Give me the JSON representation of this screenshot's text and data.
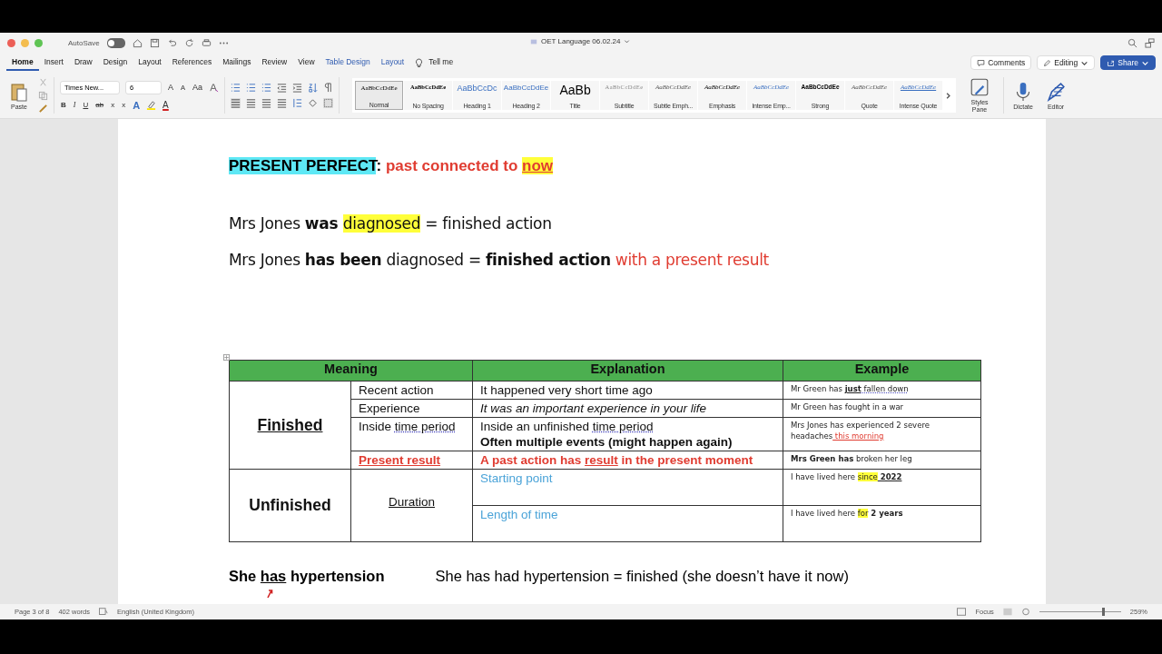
{
  "titlebar": {
    "autosave": {
      "label": "AutoSave",
      "on": false
    },
    "title": "OET Language 06.02.24"
  },
  "tabs": [
    {
      "label": "Home",
      "selected": true,
      "contextual": false
    },
    {
      "label": "Insert",
      "selected": false,
      "contextual": false
    },
    {
      "label": "Draw",
      "selected": false,
      "contextual": false
    },
    {
      "label": "Design",
      "selected": false,
      "contextual": false
    },
    {
      "label": "Layout",
      "selected": false,
      "contextual": false
    },
    {
      "label": "References",
      "selected": false,
      "contextual": false
    },
    {
      "label": "Mailings",
      "selected": false,
      "contextual": false
    },
    {
      "label": "Review",
      "selected": false,
      "contextual": false
    },
    {
      "label": "View",
      "selected": false,
      "contextual": false
    },
    {
      "label": "Table Design",
      "selected": false,
      "contextual": true
    },
    {
      "label": "Layout",
      "selected": false,
      "contextual": true
    }
  ],
  "tell_me": "Tell me",
  "actions": {
    "comments": "Comments",
    "editing": "Editing",
    "share": "Share"
  },
  "ribbon": {
    "paste": "Paste",
    "font": "Times New...",
    "size": "6",
    "case": "Aa",
    "grow": "A",
    "shrink": "A",
    "format_buttons": [
      {
        "label": "B",
        "kind": "bold"
      },
      {
        "label": "I",
        "kind": "italic"
      },
      {
        "label": "U",
        "kind": "underline"
      },
      {
        "label": "ab",
        "kind": "strike"
      },
      {
        "label": "x",
        "kind": "sub"
      },
      {
        "label": "x",
        "kind": "sup"
      }
    ],
    "effects": "A",
    "font_color": "A",
    "styles": [
      {
        "preview": "AaBbCcDdEe",
        "label": "Normal",
        "kind": "normal",
        "selected": true
      },
      {
        "preview": "AaBbCcDdEe",
        "label": "No Spacing",
        "kind": "nospace",
        "selected": false
      },
      {
        "preview": "AaBbCcDc",
        "label": "Heading 1",
        "kind": "h1",
        "selected": false
      },
      {
        "preview": "AaBbCcDdEe",
        "label": "Heading 2",
        "kind": "h2",
        "selected": false
      },
      {
        "preview": "AaBb",
        "label": "Title",
        "kind": "title",
        "selected": false
      },
      {
        "preview": "AaBbCcDdEe",
        "label": "Subtitle",
        "kind": "subtitle",
        "selected": false
      },
      {
        "preview": "AaBbCcDdEe",
        "label": "Subtle Emph...",
        "kind": "subtle",
        "selected": false
      },
      {
        "preview": "AaBbCcDdEe",
        "label": "Emphasis",
        "kind": "emphasis",
        "selected": false
      },
      {
        "preview": "AaBbCcDdEe",
        "label": "Intense Emp...",
        "kind": "intense",
        "selected": false
      },
      {
        "preview": "AaBbCcDdEe",
        "label": "Strong",
        "kind": "strong",
        "selected": false
      },
      {
        "preview": "AaBbCcDdEe",
        "label": "Quote",
        "kind": "quote",
        "selected": false
      },
      {
        "preview": "AaBbCcDdEe",
        "label": "Intense Quote",
        "kind": "iquote",
        "selected": false
      }
    ],
    "styles_pane": "Styles Pane",
    "dictate": "Dictate",
    "editor": "Editor"
  },
  "document": {
    "heading": [
      {
        "text": "PRESENT PERFECT",
        "kind": "tag"
      },
      {
        "text": ":",
        "kind": "bold"
      },
      {
        "text": " past connected to ",
        "kind": "alert"
      },
      {
        "text": "now",
        "kind": "keyword"
      }
    ],
    "lines": [
      [
        {
          "text": "Mrs Jones ",
          "kind": "plain"
        },
        {
          "text": "was ",
          "kind": "bold"
        },
        {
          "text": "diagnosed",
          "kind": "marked"
        },
        {
          "text": " = finished action",
          "kind": "plain"
        }
      ],
      [
        {
          "text": "Mrs Jones ",
          "kind": "plain"
        },
        {
          "text": "has been",
          "kind": "bold"
        },
        {
          "text": " diagnosed = ",
          "kind": "plain"
        },
        {
          "text": "finished action",
          "kind": "bold"
        },
        {
          "text": " with a present result",
          "kind": "red"
        }
      ]
    ],
    "table": {
      "columns": [
        "Meaning",
        "Explanation",
        "Example"
      ],
      "groups": [
        {
          "label": "Finished",
          "rows": [
            {
              "meaning": [
                {
                  "text": "Recent action",
                  "kind": "plain"
                }
              ],
              "explanation": [
                [
                  {
                    "text": "It happened very short time ago",
                    "kind": "plain"
                  }
                ]
              ],
              "example": [
                {
                  "text": "Mr Green has ",
                  "kind": "plain"
                },
                {
                  "text": "just",
                  "kind": "strongline"
                },
                {
                  "text": " fallen down",
                  "kind": "dotted"
                }
              ]
            },
            {
              "meaning": [
                {
                  "text": "Experience",
                  "kind": "plain"
                }
              ],
              "explanation": [
                [
                  {
                    "text": "It was an important experience in your life",
                    "kind": "italic"
                  }
                ]
              ],
              "example": [
                {
                  "text": "Mr Green has fought in a war",
                  "kind": "plain"
                }
              ]
            },
            {
              "meaning": [
                {
                  "text": "Inside ",
                  "kind": "plain"
                },
                {
                  "text": "time period",
                  "kind": "dotted"
                }
              ],
              "explanation": [
                [
                  {
                    "text": "Inside an unfinished ",
                    "kind": "plain"
                  },
                  {
                    "text": "time period",
                    "kind": "dotted"
                  }
                ],
                [
                  {
                    "text": "Often multiple events (might happen again)",
                    "kind": "bold"
                  }
                ]
              ],
              "example": [
                {
                  "text": "Mrs Jones has experienced 2 severe headaches",
                  "kind": "plain"
                },
                {
                  "text": " this morning",
                  "kind": "redline"
                }
              ]
            },
            {
              "meaning": [
                {
                  "text": "Present result",
                  "kind": "alertline"
                }
              ],
              "explanation": [
                [
                  {
                    "text": "A past action has ",
                    "kind": "alert"
                  },
                  {
                    "text": "result",
                    "kind": "alertline"
                  },
                  {
                    "text": " in the present moment",
                    "kind": "alert"
                  }
                ]
              ],
              "example": [
                {
                  "text": "Mrs Green has",
                  "kind": "bold"
                },
                {
                  "text": " broken her leg",
                  "kind": "plain"
                }
              ]
            }
          ]
        },
        {
          "label": "Unfinished",
          "sub": "Duration",
          "rows": [
            {
              "explanation": [
                [
                  {
                    "text": "Starting point",
                    "kind": "blue"
                  }
                ]
              ],
              "example": [
                {
                  "text": "I have lived here ",
                  "kind": "plain"
                },
                {
                  "text": "since",
                  "kind": "marked"
                },
                {
                  "text": " 2022",
                  "kind": "strongline"
                }
              ]
            },
            {
              "explanation": [
                [
                  {
                    "text": "Length of time",
                    "kind": "blue"
                  }
                ]
              ],
              "example": [
                {
                  "text": "I have lived here ",
                  "kind": "plain"
                },
                {
                  "text": "for",
                  "kind": "marked"
                },
                {
                  "text": " 2 years",
                  "kind": "bold"
                }
              ]
            }
          ]
        }
      ]
    },
    "bottom": [
      [
        {
          "text": "She ",
          "kind": "bold"
        },
        {
          "text": "has",
          "kind": "strongline"
        },
        {
          "text": " hypertension",
          "kind": "bold"
        }
      ],
      [
        {
          "text": "She has had hypertension = finished (she doesn’t have it now)",
          "kind": "plain"
        }
      ]
    ]
  },
  "status_bar": {
    "page": "Page 3 of 8",
    "words": "402 words",
    "language": "English (United Kingdom)",
    "focus": "Focus",
    "zoom_slider": {
      "level": 0.78
    },
    "zoom": "259%"
  }
}
